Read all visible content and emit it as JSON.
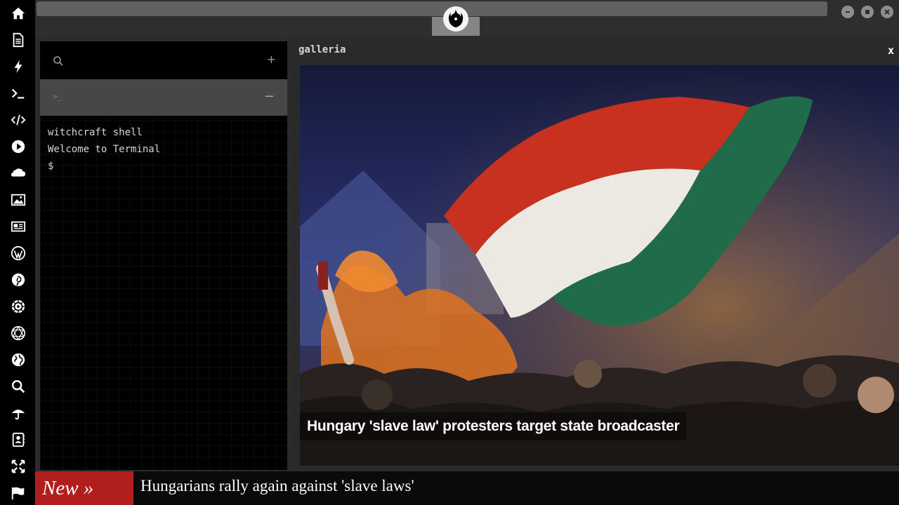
{
  "sidebar": {
    "icons": [
      "home-icon",
      "document-icon",
      "lightning-icon",
      "terminal-icon",
      "code-icon",
      "play-icon",
      "cloud-icon",
      "image-icon",
      "newspaper-icon",
      "wordpress-icon",
      "pinterest-icon",
      "galactic-empire-icon",
      "network-sphere-icon",
      "globe-icon",
      "search-icon",
      "umbrella-icon",
      "contacts-icon",
      "expand-icon",
      "flag-icon"
    ]
  },
  "topbar": {
    "logo_icon": "rebel-alliance-icon",
    "window_controls": [
      "minimize-icon",
      "maximize-icon",
      "close-icon"
    ]
  },
  "terminal": {
    "plus_label": "+",
    "prompt_icon_label": ">_",
    "minus_label": "−",
    "lines": [
      "witchcraft shell",
      "Welcome to Terminal",
      "$"
    ]
  },
  "gallery": {
    "title": "galleria",
    "close_label": "x",
    "caption": "Hungary 'slave law' protesters target state broadcaster"
  },
  "ticker": {
    "badge": "New »",
    "headline": "Hungarians rally again against 'slave laws'"
  },
  "colors": {
    "sidebar_bg": "#000000",
    "ticker_badge": "#b01e1e",
    "flag_red": "#c8311f",
    "flag_white": "#ece9e2",
    "flag_green": "#1f6b4a"
  }
}
